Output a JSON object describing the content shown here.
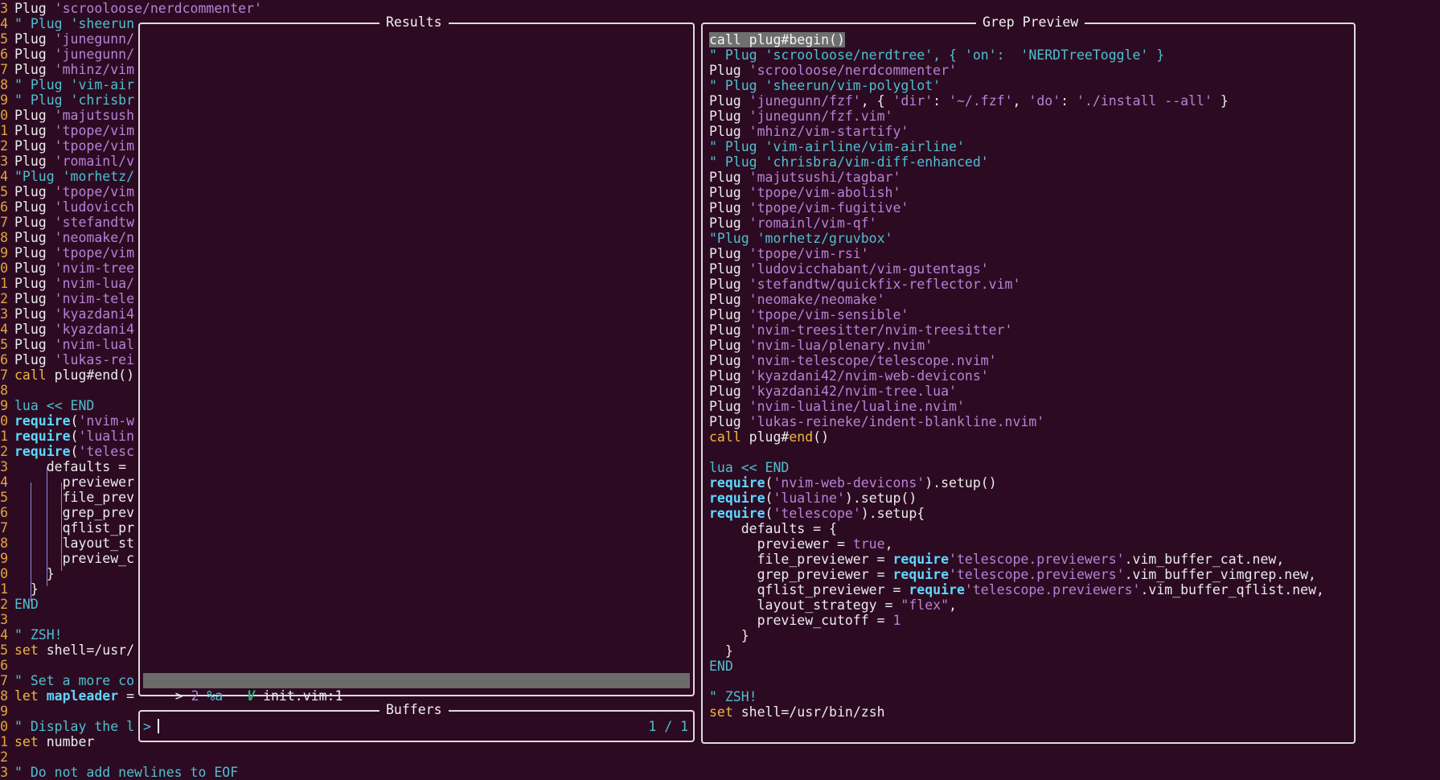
{
  "gutter_numbers": [
    "3",
    "4",
    "5",
    "6",
    "7",
    "8",
    "9",
    "0",
    "1",
    "2",
    "3",
    "4",
    "5",
    "6",
    "7",
    "8",
    "9",
    "0",
    "1",
    "2",
    "3",
    "4",
    "5",
    "6",
    "7",
    "8",
    "9",
    "0",
    "1",
    "2",
    "3",
    "4",
    "5",
    "6",
    "7",
    "8",
    "9",
    "0",
    "1",
    "2",
    "3",
    "4",
    "5",
    "6",
    "7",
    "8",
    "9",
    "0",
    "1",
    "2",
    "3"
  ],
  "background_editor": {
    "lines": [
      [
        {
          "t": "Plug ",
          "c": ""
        },
        {
          "t": "'scrooloose/nerdcommenter'",
          "c": "str"
        }
      ],
      [
        {
          "t": "\" Plug 'sheerun",
          "c": "cmt"
        }
      ],
      [
        {
          "t": "Plug ",
          "c": ""
        },
        {
          "t": "'junegunn/",
          "c": "str"
        }
      ],
      [
        {
          "t": "Plug ",
          "c": ""
        },
        {
          "t": "'junegunn/",
          "c": "str"
        }
      ],
      [
        {
          "t": "Plug ",
          "c": ""
        },
        {
          "t": "'mhinz/vim",
          "c": "str"
        }
      ],
      [
        {
          "t": "\" Plug 'vim-air",
          "c": "cmt"
        }
      ],
      [
        {
          "t": "\" Plug 'chrisbr",
          "c": "cmt"
        }
      ],
      [
        {
          "t": "Plug ",
          "c": ""
        },
        {
          "t": "'majutsush",
          "c": "str"
        }
      ],
      [
        {
          "t": "Plug ",
          "c": ""
        },
        {
          "t": "'tpope/vim",
          "c": "str"
        }
      ],
      [
        {
          "t": "Plug ",
          "c": ""
        },
        {
          "t": "'tpope/vim",
          "c": "str"
        }
      ],
      [
        {
          "t": "Plug ",
          "c": ""
        },
        {
          "t": "'romainl/v",
          "c": "str"
        }
      ],
      [
        {
          "t": "\"Plug 'morhetz/",
          "c": "cmt"
        }
      ],
      [
        {
          "t": "Plug ",
          "c": ""
        },
        {
          "t": "'tpope/vim",
          "c": "str"
        }
      ],
      [
        {
          "t": "Plug ",
          "c": ""
        },
        {
          "t": "'ludovicch",
          "c": "str"
        }
      ],
      [
        {
          "t": "Plug ",
          "c": ""
        },
        {
          "t": "'stefandtw",
          "c": "str"
        }
      ],
      [
        {
          "t": "Plug ",
          "c": ""
        },
        {
          "t": "'neomake/n",
          "c": "str"
        }
      ],
      [
        {
          "t": "Plug ",
          "c": ""
        },
        {
          "t": "'tpope/vim",
          "c": "str"
        }
      ],
      [
        {
          "t": "Plug ",
          "c": ""
        },
        {
          "t": "'nvim-tree",
          "c": "str"
        }
      ],
      [
        {
          "t": "Plug ",
          "c": ""
        },
        {
          "t": "'nvim-lua/",
          "c": "str"
        }
      ],
      [
        {
          "t": "Plug ",
          "c": ""
        },
        {
          "t": "'nvim-tele",
          "c": "str"
        }
      ],
      [
        {
          "t": "Plug ",
          "c": ""
        },
        {
          "t": "'kyazdani4",
          "c": "str"
        }
      ],
      [
        {
          "t": "Plug ",
          "c": ""
        },
        {
          "t": "'kyazdani4",
          "c": "str"
        }
      ],
      [
        {
          "t": "Plug ",
          "c": ""
        },
        {
          "t": "'nvim-lual",
          "c": "str"
        }
      ],
      [
        {
          "t": "Plug ",
          "c": ""
        },
        {
          "t": "'lukas-rei",
          "c": "str"
        }
      ],
      [
        {
          "t": "call",
          "c": "kw"
        },
        {
          "t": " plug#end()",
          "c": ""
        }
      ],
      [],
      [
        {
          "t": "lua << END",
          "c": "cmt"
        }
      ],
      [
        {
          "t": "require",
          "c": "fn"
        },
        {
          "t": "(",
          "c": ""
        },
        {
          "t": "'nvim-w",
          "c": "str"
        }
      ],
      [
        {
          "t": "require",
          "c": "fn"
        },
        {
          "t": "(",
          "c": ""
        },
        {
          "t": "'lualin",
          "c": "str"
        }
      ],
      [
        {
          "t": "require",
          "c": "fn"
        },
        {
          "t": "(",
          "c": ""
        },
        {
          "t": "'telesc",
          "c": "str"
        }
      ],
      [
        {
          "t": "    defaults =",
          "c": ""
        }
      ],
      [
        {
          "t": "      previewer",
          "c": ""
        }
      ],
      [
        {
          "t": "      file_prev",
          "c": ""
        }
      ],
      [
        {
          "t": "      grep_prev",
          "c": ""
        }
      ],
      [
        {
          "t": "      qflist_pr",
          "c": ""
        }
      ],
      [
        {
          "t": "      layout_st",
          "c": ""
        }
      ],
      [
        {
          "t": "      preview_c",
          "c": ""
        }
      ],
      [
        {
          "t": "    }",
          "c": ""
        }
      ],
      [
        {
          "t": "  }",
          "c": ""
        }
      ],
      [
        {
          "t": "END",
          "c": "cmt"
        }
      ],
      [],
      [
        {
          "t": "\" ZSH!",
          "c": "cmt"
        }
      ],
      [
        {
          "t": "set",
          "c": "kw"
        },
        {
          "t": " shell=/usr/",
          "c": ""
        }
      ],
      [],
      [
        {
          "t": "\" Set a more co",
          "c": "cmt"
        }
      ],
      [
        {
          "t": "let",
          "c": "kw"
        },
        {
          "t": " mapleader",
          "c": "fn"
        },
        {
          "t": " =",
          "c": ""
        }
      ],
      [],
      [
        {
          "t": "\" Display the l",
          "c": "cmt"
        }
      ],
      [
        {
          "t": "set",
          "c": "kw"
        },
        {
          "t": " number",
          "c": ""
        }
      ],
      [],
      [
        {
          "t": "\" Do not add newlines to EOF",
          "c": "cmt"
        }
      ]
    ]
  },
  "results_panel": {
    "title": "Results",
    "selected_row": {
      "prefix": "> ",
      "count": "2",
      "flags": "%a",
      "icon_glyph": "V",
      "filename": "init.vim:1"
    }
  },
  "buffers_panel": {
    "title": "Buffers",
    "prompt": ">",
    "counter": "1 / 1"
  },
  "preview_panel": {
    "title": "Grep Preview",
    "lines": [
      [
        {
          "t": "call plug#begin()",
          "c": "sel"
        }
      ],
      [
        {
          "t": "\" Plug 'scrooloose/nerdtree', { 'on':  'NERDTreeToggle' }",
          "c": "cmt"
        }
      ],
      [
        {
          "t": "Plug ",
          "c": ""
        },
        {
          "t": "'scrooloose/nerdcommenter'",
          "c": "str"
        }
      ],
      [
        {
          "t": "\" Plug 'sheerun/vim-polyglot'",
          "c": "cmt"
        }
      ],
      [
        {
          "t": "Plug ",
          "c": ""
        },
        {
          "t": "'junegunn/fzf'",
          "c": "str"
        },
        {
          "t": ", { ",
          "c": ""
        },
        {
          "t": "'dir'",
          "c": "str"
        },
        {
          "t": ": ",
          "c": ""
        },
        {
          "t": "'~/.fzf'",
          "c": "str"
        },
        {
          "t": ", ",
          "c": ""
        },
        {
          "t": "'do'",
          "c": "str"
        },
        {
          "t": ": ",
          "c": ""
        },
        {
          "t": "'./install --all'",
          "c": "str"
        },
        {
          "t": " }",
          "c": ""
        }
      ],
      [
        {
          "t": "Plug ",
          "c": ""
        },
        {
          "t": "'junegunn/fzf.vim'",
          "c": "str"
        }
      ],
      [
        {
          "t": "Plug ",
          "c": ""
        },
        {
          "t": "'mhinz/vim-startify'",
          "c": "str"
        }
      ],
      [
        {
          "t": "\" Plug 'vim-airline/vim-airline'",
          "c": "cmt"
        }
      ],
      [
        {
          "t": "\" Plug 'chrisbra/vim-diff-enhanced'",
          "c": "cmt"
        }
      ],
      [
        {
          "t": "Plug ",
          "c": ""
        },
        {
          "t": "'majutsushi/tagbar'",
          "c": "str"
        }
      ],
      [
        {
          "t": "Plug ",
          "c": ""
        },
        {
          "t": "'tpope/vim-abolish'",
          "c": "str"
        }
      ],
      [
        {
          "t": "Plug ",
          "c": ""
        },
        {
          "t": "'tpope/vim-fugitive'",
          "c": "str"
        }
      ],
      [
        {
          "t": "Plug ",
          "c": ""
        },
        {
          "t": "'romainl/vim-qf'",
          "c": "str"
        }
      ],
      [
        {
          "t": "\"Plug 'morhetz/gruvbox'",
          "c": "cmt"
        }
      ],
      [
        {
          "t": "Plug ",
          "c": ""
        },
        {
          "t": "'tpope/vim-rsi'",
          "c": "str"
        }
      ],
      [
        {
          "t": "Plug ",
          "c": ""
        },
        {
          "t": "'ludovicchabant/vim-gutentags'",
          "c": "str"
        }
      ],
      [
        {
          "t": "Plug ",
          "c": ""
        },
        {
          "t": "'stefandtw/quickfix-reflector.vim'",
          "c": "str"
        }
      ],
      [
        {
          "t": "Plug ",
          "c": ""
        },
        {
          "t": "'neomake/neomake'",
          "c": "str"
        }
      ],
      [
        {
          "t": "Plug ",
          "c": ""
        },
        {
          "t": "'tpope/vim-sensible'",
          "c": "str"
        }
      ],
      [
        {
          "t": "Plug ",
          "c": ""
        },
        {
          "t": "'nvim-treesitter/nvim-treesitter'",
          "c": "str"
        }
      ],
      [
        {
          "t": "Plug ",
          "c": ""
        },
        {
          "t": "'nvim-lua/plenary.nvim'",
          "c": "str"
        }
      ],
      [
        {
          "t": "Plug ",
          "c": ""
        },
        {
          "t": "'nvim-telescope/telescope.nvim'",
          "c": "str"
        }
      ],
      [
        {
          "t": "Plug ",
          "c": ""
        },
        {
          "t": "'kyazdani42/nvim-web-devicons'",
          "c": "str"
        }
      ],
      [
        {
          "t": "Plug ",
          "c": ""
        },
        {
          "t": "'kyazdani42/nvim-tree.lua'",
          "c": "str"
        }
      ],
      [
        {
          "t": "Plug ",
          "c": ""
        },
        {
          "t": "'nvim-lualine/lualine.nvim'",
          "c": "str"
        }
      ],
      [
        {
          "t": "Plug ",
          "c": ""
        },
        {
          "t": "'lukas-reineke/indent-blankline.nvim'",
          "c": "str"
        }
      ],
      [
        {
          "t": "call",
          "c": "kw"
        },
        {
          "t": " plug#",
          "c": ""
        },
        {
          "t": "end",
          "c": "kw"
        },
        {
          "t": "()",
          "c": ""
        }
      ],
      [],
      [
        {
          "t": "lua << END",
          "c": "cmt"
        }
      ],
      [
        {
          "t": "require",
          "c": "fn"
        },
        {
          "t": "(",
          "c": ""
        },
        {
          "t": "'nvim-web-devicons'",
          "c": "str"
        },
        {
          "t": ").setup()",
          "c": ""
        }
      ],
      [
        {
          "t": "require",
          "c": "fn"
        },
        {
          "t": "(",
          "c": ""
        },
        {
          "t": "'lualine'",
          "c": "str"
        },
        {
          "t": ").setup()",
          "c": ""
        }
      ],
      [
        {
          "t": "require",
          "c": "fn"
        },
        {
          "t": "(",
          "c": ""
        },
        {
          "t": "'telescope'",
          "c": "str"
        },
        {
          "t": ").setup{",
          "c": ""
        }
      ],
      [
        {
          "t": "    defaults = {",
          "c": ""
        }
      ],
      [
        {
          "t": "      previewer = ",
          "c": ""
        },
        {
          "t": "true",
          "c": "num"
        },
        {
          "t": ",",
          "c": ""
        }
      ],
      [
        {
          "t": "      file_previewer = ",
          "c": ""
        },
        {
          "t": "require",
          "c": "fn"
        },
        {
          "t": "'telescope.previewers'",
          "c": "str"
        },
        {
          "t": ".vim_buffer_cat.new,",
          "c": ""
        }
      ],
      [
        {
          "t": "      grep_previewer = ",
          "c": ""
        },
        {
          "t": "require",
          "c": "fn"
        },
        {
          "t": "'telescope.previewers'",
          "c": "str"
        },
        {
          "t": ".vim_buffer_vimgrep.new,",
          "c": ""
        }
      ],
      [
        {
          "t": "      qflist_previewer = ",
          "c": ""
        },
        {
          "t": "require",
          "c": "fn"
        },
        {
          "t": "'telescope.previewers'",
          "c": "str"
        },
        {
          "t": ".vim_buffer_qflist.new,",
          "c": ""
        }
      ],
      [
        {
          "t": "      layout_strategy = ",
          "c": ""
        },
        {
          "t": "\"flex\"",
          "c": "str"
        },
        {
          "t": ",",
          "c": ""
        }
      ],
      [
        {
          "t": "      preview_cutoff = ",
          "c": ""
        },
        {
          "t": "1",
          "c": "num"
        }
      ],
      [
        {
          "t": "    }",
          "c": ""
        }
      ],
      [
        {
          "t": "  }",
          "c": ""
        }
      ],
      [
        {
          "t": "END",
          "c": "cmt"
        }
      ],
      [],
      [
        {
          "t": "\" ZSH!",
          "c": "cmt"
        }
      ],
      [
        {
          "t": "set",
          "c": "kw"
        },
        {
          "t": " shell=/usr/bin/zsh",
          "c": ""
        }
      ]
    ]
  },
  "colors": {
    "background": "#2c0b22",
    "keyword": "#f1b840",
    "string": "#b882d6",
    "comment": "#4fbfd0",
    "function": "#5fd7ff",
    "line_number": "#e6a43c",
    "border": "#dcdcdc",
    "selection": "#6f6f6f"
  }
}
